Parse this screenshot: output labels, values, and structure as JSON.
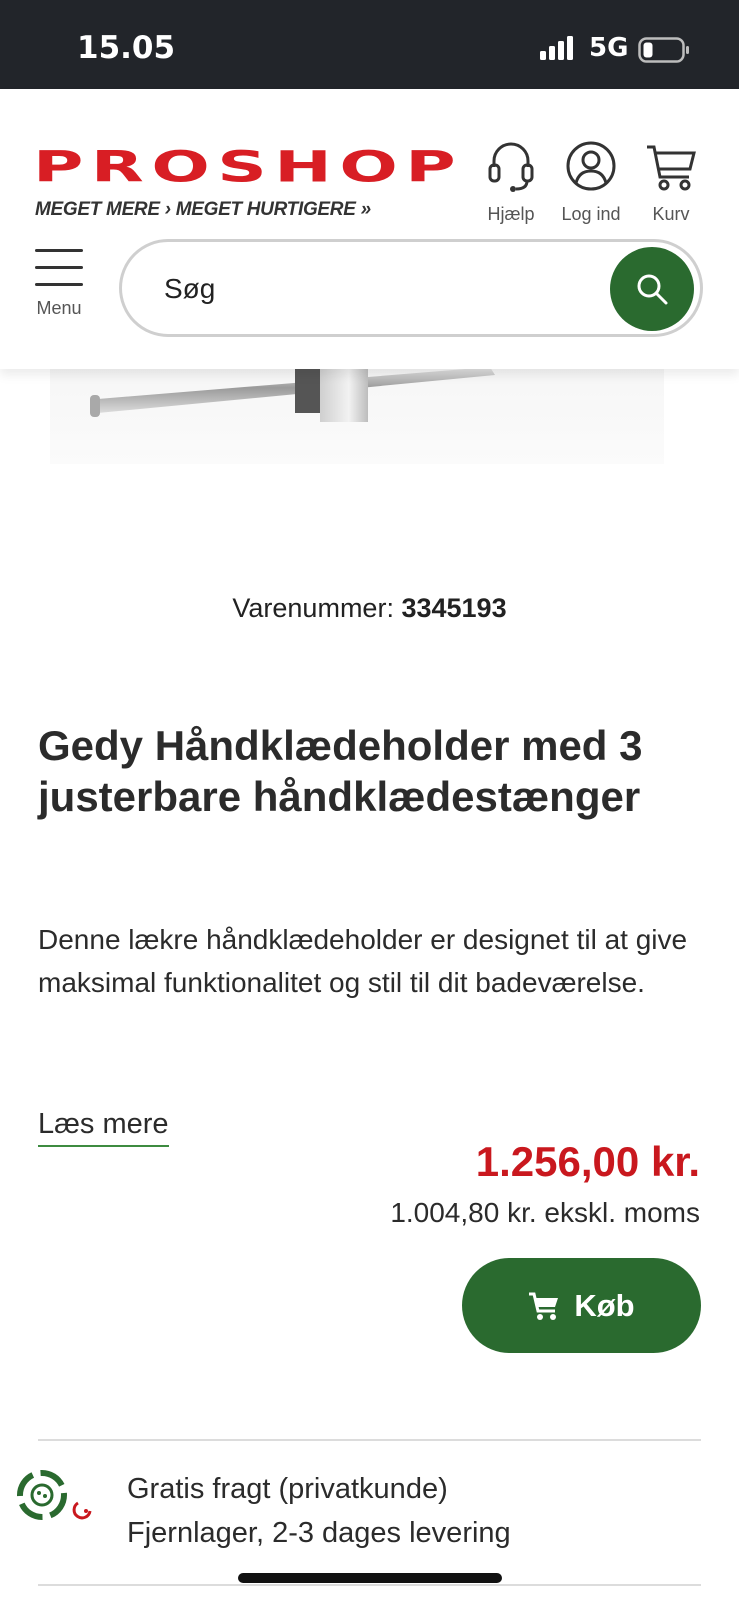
{
  "status_bar": {
    "time": "15.05",
    "network": "5G",
    "battery_level": 0.2
  },
  "header": {
    "brand": "PROSHOP",
    "tagline": "MEGET MERE › MEGET HURTIGERE »",
    "help_label": "Hjælp",
    "login_label": "Log ind",
    "cart_label": "Kurv",
    "menu_label": "Menu",
    "search_placeholder": "Søg"
  },
  "product": {
    "item_number_label": "Varenummer:",
    "item_number": "3345193",
    "title": "Gedy Håndklædeholder med 3 justerbare håndklædestænger",
    "description": "Denne lækre håndklædeholder er designet til at give maksimal funktionalitet og stil til dit badeværelse.",
    "read_more_label": "Læs mere",
    "price": "1.256,00 kr.",
    "price_ex_vat": "1.004,80 kr. ekskl. moms",
    "buy_label": "Køb"
  },
  "shipping": {
    "line1": "Gratis fragt (privatkunde)",
    "line2": "Fjernlager, 2-3 dages levering"
  },
  "colors": {
    "brand_red": "#d81e24",
    "action_green": "#2a6a2f",
    "price_red": "#c9181e"
  },
  "icons": [
    "headset-icon",
    "user-icon",
    "cart-icon",
    "hamburger-icon",
    "search-icon",
    "shipping-icon"
  ]
}
